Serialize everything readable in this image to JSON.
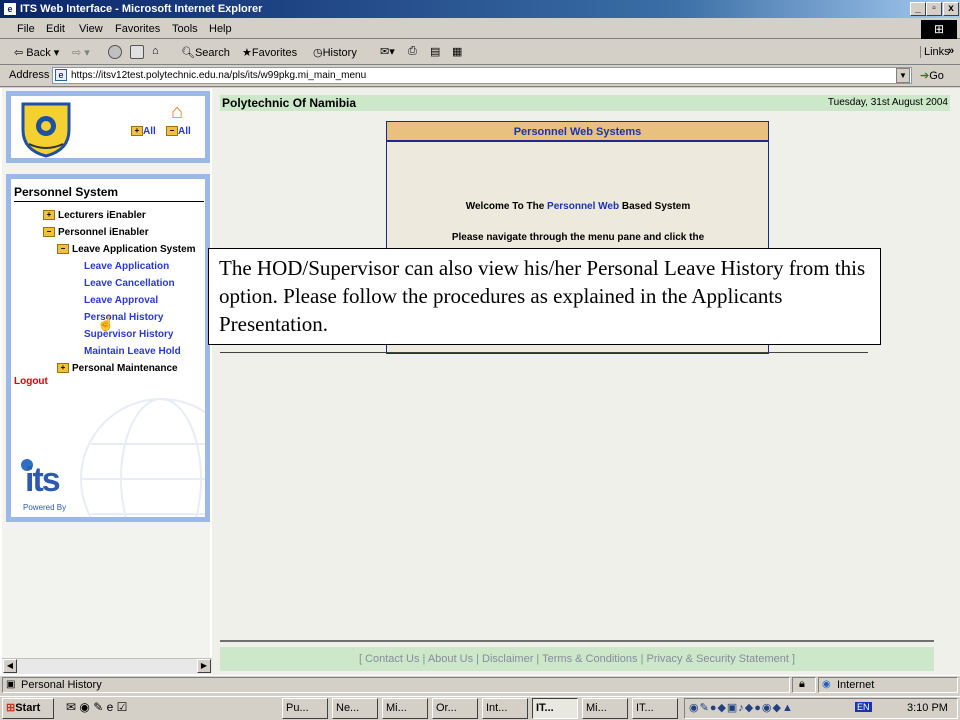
{
  "window": {
    "title": "ITS Web Interface - Microsoft Internet Explorer",
    "min": "_",
    "max": "▫",
    "close": "x"
  },
  "menu": [
    "File",
    "Edit",
    "View",
    "Favorites",
    "Tools",
    "Help"
  ],
  "toolbar": {
    "back": "Back",
    "search": "Search",
    "favorites": "Favorites",
    "history": "History",
    "links": "Links"
  },
  "address": {
    "label": "Address",
    "url": "https://itsv12test.polytechnic.edu.na/pls/its/w99pkg.mi_main_menu",
    "go": "Go"
  },
  "logo_panel": {
    "all_expand": "All",
    "all_collapse": "All"
  },
  "sidebar": {
    "title": "Personnel System",
    "items": [
      {
        "label": "Lecturers iEnabler",
        "level": 1,
        "type": "folder"
      },
      {
        "label": "Personnel iEnabler",
        "level": 1,
        "type": "folder"
      },
      {
        "label": "Leave Application System",
        "level": 2,
        "type": "folder"
      },
      {
        "label": "Leave Application",
        "level": 3,
        "type": "link"
      },
      {
        "label": "Leave Cancellation",
        "level": 3,
        "type": "link"
      },
      {
        "label": "Leave Approval",
        "level": 3,
        "type": "link"
      },
      {
        "label": "Personal History",
        "level": 3,
        "type": "link"
      },
      {
        "label": "Supervisor History",
        "level": 3,
        "type": "link"
      },
      {
        "label": "Maintain Leave Hold",
        "level": 3,
        "type": "link"
      },
      {
        "label": "Personal Maintenance",
        "level": 2,
        "type": "folder"
      }
    ],
    "logout": "Logout",
    "powered_by": "Powered By",
    "its_logo": "its"
  },
  "header": {
    "org": "Polytechnic Of Namibia",
    "date": "Tuesday, 31st August 2004"
  },
  "pws": {
    "title": "Personnel Web Systems",
    "welcome_pre": "Welcome To The ",
    "welcome_hl": "Personnel Web",
    "welcome_post": " Based System",
    "navigate": "Please navigate through the menu pane  and click the"
  },
  "callout": "The HOD/Supervisor can also view his/her Personal Leave History from this option. Please follow the procedures as explained in the Applicants Presentation.",
  "footer": "[ Contact Us | About Us | Disclaimer | Terms & Conditions | Privacy & Security Statement ]",
  "status": {
    "text": "Personal History",
    "zone": "Internet"
  },
  "taskbar": {
    "start": "Start",
    "tasks": [
      "Pu...",
      "Ne...",
      "Mi...",
      "Or...",
      "Int...",
      "IT...",
      "Mi...",
      "IT..."
    ],
    "time": "3:10 PM",
    "lang": "EN"
  },
  "colors": {
    "accent": "#0a246a",
    "link": "#2a3ad0",
    "logout": "#e00000",
    "header_green": "#cce8c8",
    "panel_border": "#9cb8e8"
  }
}
